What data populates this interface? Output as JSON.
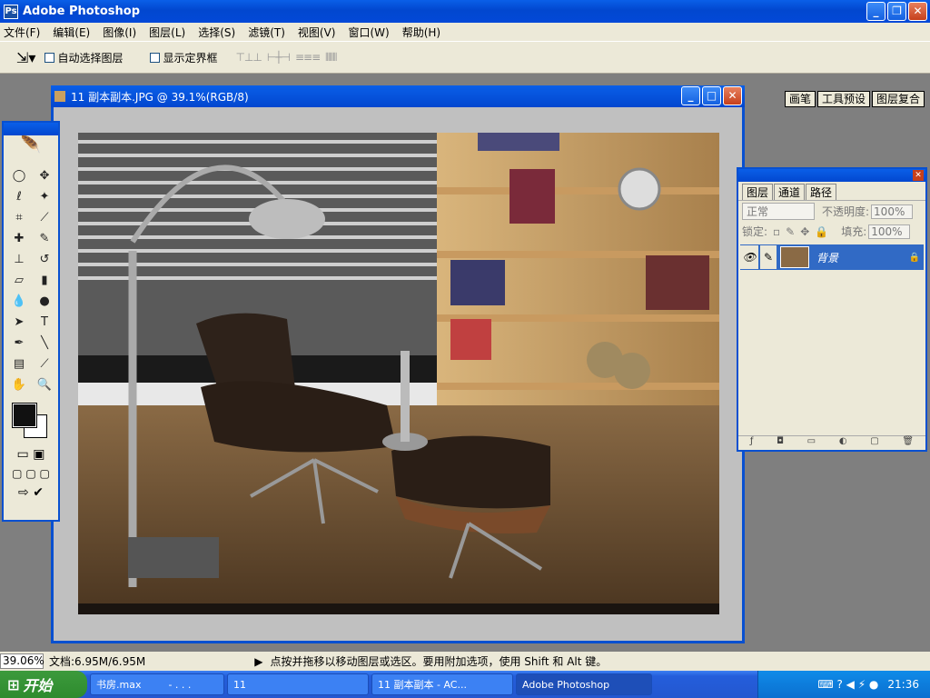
{
  "app": {
    "title": "Adobe Photoshop"
  },
  "menu": [
    "文件(F)",
    "编辑(E)",
    "图像(I)",
    "图层(L)",
    "选择(S)",
    "滤镜(T)",
    "视图(V)",
    "窗口(W)",
    "帮助(H)"
  ],
  "options": {
    "auto_select": "自动选择图层",
    "show_bounds": "显示定界框"
  },
  "palette_well": [
    "画笔",
    "工具预设",
    "图层复合"
  ],
  "document": {
    "title": "11 副本副本.JPG @ 39.1%(RGB/8)"
  },
  "layers": {
    "tabs": [
      "图层",
      "通道",
      "路径"
    ],
    "blend": "正常",
    "opacity_label": "不透明度:",
    "opacity": "100%",
    "lock_label": "锁定:",
    "fill_label": "填充:",
    "fill": "100%",
    "layer_name": "背景"
  },
  "status": {
    "zoom": "39.06%",
    "doc": "文档:6.95M/6.95M",
    "hint": "点按并拖移以移动图层或选区。要用附加选项，使用 Shift 和 Alt 键。"
  },
  "taskbar": {
    "start": "开始",
    "items": [
      "书房.max",
      "- . . .",
      "11",
      "11 副本副本 - AC...",
      "Adobe Photoshop"
    ],
    "clock": "21:36"
  }
}
